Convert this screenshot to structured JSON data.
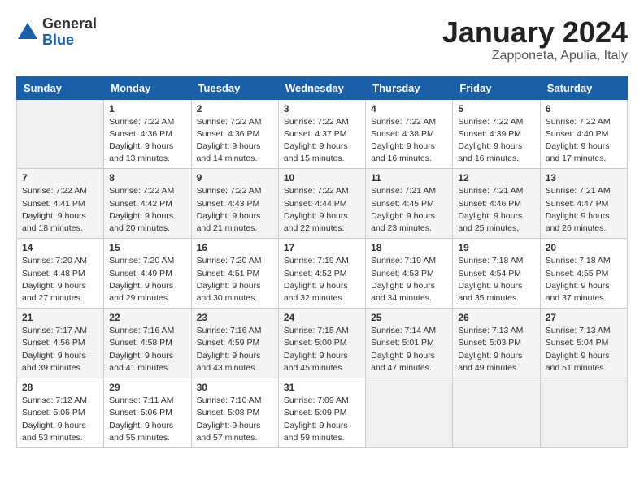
{
  "header": {
    "logo_general": "General",
    "logo_blue": "Blue",
    "month_title": "January 2024",
    "location": "Zapponeta, Apulia, Italy"
  },
  "days_of_week": [
    "Sunday",
    "Monday",
    "Tuesday",
    "Wednesday",
    "Thursday",
    "Friday",
    "Saturday"
  ],
  "weeks": [
    [
      {
        "day": "",
        "empty": true
      },
      {
        "day": "1",
        "sunrise": "7:22 AM",
        "sunset": "4:36 PM",
        "daylight": "9 hours and 13 minutes."
      },
      {
        "day": "2",
        "sunrise": "7:22 AM",
        "sunset": "4:36 PM",
        "daylight": "9 hours and 14 minutes."
      },
      {
        "day": "3",
        "sunrise": "7:22 AM",
        "sunset": "4:37 PM",
        "daylight": "9 hours and 15 minutes."
      },
      {
        "day": "4",
        "sunrise": "7:22 AM",
        "sunset": "4:38 PM",
        "daylight": "9 hours and 16 minutes."
      },
      {
        "day": "5",
        "sunrise": "7:22 AM",
        "sunset": "4:39 PM",
        "daylight": "9 hours and 16 minutes."
      },
      {
        "day": "6",
        "sunrise": "7:22 AM",
        "sunset": "4:40 PM",
        "daylight": "9 hours and 17 minutes."
      }
    ],
    [
      {
        "day": "7",
        "sunrise": "7:22 AM",
        "sunset": "4:41 PM",
        "daylight": "9 hours and 18 minutes."
      },
      {
        "day": "8",
        "sunrise": "7:22 AM",
        "sunset": "4:42 PM",
        "daylight": "9 hours and 20 minutes."
      },
      {
        "day": "9",
        "sunrise": "7:22 AM",
        "sunset": "4:43 PM",
        "daylight": "9 hours and 21 minutes."
      },
      {
        "day": "10",
        "sunrise": "7:22 AM",
        "sunset": "4:44 PM",
        "daylight": "9 hours and 22 minutes."
      },
      {
        "day": "11",
        "sunrise": "7:21 AM",
        "sunset": "4:45 PM",
        "daylight": "9 hours and 23 minutes."
      },
      {
        "day": "12",
        "sunrise": "7:21 AM",
        "sunset": "4:46 PM",
        "daylight": "9 hours and 25 minutes."
      },
      {
        "day": "13",
        "sunrise": "7:21 AM",
        "sunset": "4:47 PM",
        "daylight": "9 hours and 26 minutes."
      }
    ],
    [
      {
        "day": "14",
        "sunrise": "7:20 AM",
        "sunset": "4:48 PM",
        "daylight": "9 hours and 27 minutes."
      },
      {
        "day": "15",
        "sunrise": "7:20 AM",
        "sunset": "4:49 PM",
        "daylight": "9 hours and 29 minutes."
      },
      {
        "day": "16",
        "sunrise": "7:20 AM",
        "sunset": "4:51 PM",
        "daylight": "9 hours and 30 minutes."
      },
      {
        "day": "17",
        "sunrise": "7:19 AM",
        "sunset": "4:52 PM",
        "daylight": "9 hours and 32 minutes."
      },
      {
        "day": "18",
        "sunrise": "7:19 AM",
        "sunset": "4:53 PM",
        "daylight": "9 hours and 34 minutes."
      },
      {
        "day": "19",
        "sunrise": "7:18 AM",
        "sunset": "4:54 PM",
        "daylight": "9 hours and 35 minutes."
      },
      {
        "day": "20",
        "sunrise": "7:18 AM",
        "sunset": "4:55 PM",
        "daylight": "9 hours and 37 minutes."
      }
    ],
    [
      {
        "day": "21",
        "sunrise": "7:17 AM",
        "sunset": "4:56 PM",
        "daylight": "9 hours and 39 minutes."
      },
      {
        "day": "22",
        "sunrise": "7:16 AM",
        "sunset": "4:58 PM",
        "daylight": "9 hours and 41 minutes."
      },
      {
        "day": "23",
        "sunrise": "7:16 AM",
        "sunset": "4:59 PM",
        "daylight": "9 hours and 43 minutes."
      },
      {
        "day": "24",
        "sunrise": "7:15 AM",
        "sunset": "5:00 PM",
        "daylight": "9 hours and 45 minutes."
      },
      {
        "day": "25",
        "sunrise": "7:14 AM",
        "sunset": "5:01 PM",
        "daylight": "9 hours and 47 minutes."
      },
      {
        "day": "26",
        "sunrise": "7:13 AM",
        "sunset": "5:03 PM",
        "daylight": "9 hours and 49 minutes."
      },
      {
        "day": "27",
        "sunrise": "7:13 AM",
        "sunset": "5:04 PM",
        "daylight": "9 hours and 51 minutes."
      }
    ],
    [
      {
        "day": "28",
        "sunrise": "7:12 AM",
        "sunset": "5:05 PM",
        "daylight": "9 hours and 53 minutes."
      },
      {
        "day": "29",
        "sunrise": "7:11 AM",
        "sunset": "5:06 PM",
        "daylight": "9 hours and 55 minutes."
      },
      {
        "day": "30",
        "sunrise": "7:10 AM",
        "sunset": "5:08 PM",
        "daylight": "9 hours and 57 minutes."
      },
      {
        "day": "31",
        "sunrise": "7:09 AM",
        "sunset": "5:09 PM",
        "daylight": "9 hours and 59 minutes."
      },
      {
        "day": "",
        "empty": true
      },
      {
        "day": "",
        "empty": true
      },
      {
        "day": "",
        "empty": true
      }
    ]
  ],
  "labels": {
    "sunrise_prefix": "Sunrise: ",
    "sunset_prefix": "Sunset: ",
    "daylight_prefix": "Daylight: "
  }
}
